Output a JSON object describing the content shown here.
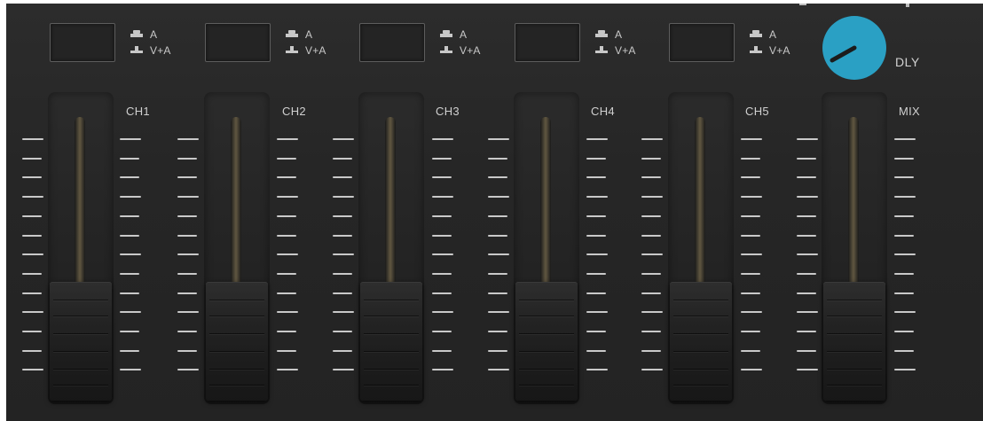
{
  "mode_legend": {
    "a_label": "A",
    "va_label": "V+A"
  },
  "channels": [
    {
      "label": "CH1"
    },
    {
      "label": "CH2"
    },
    {
      "label": "CH3"
    },
    {
      "label": "CH4"
    },
    {
      "label": "CH5"
    },
    {
      "label": "MIX"
    }
  ],
  "knob": {
    "label": "DLY",
    "color": "#2aa0c4"
  },
  "colors": {
    "panel": "#262626",
    "text": "#d0d0d0",
    "accent": "#2aa0c4"
  }
}
